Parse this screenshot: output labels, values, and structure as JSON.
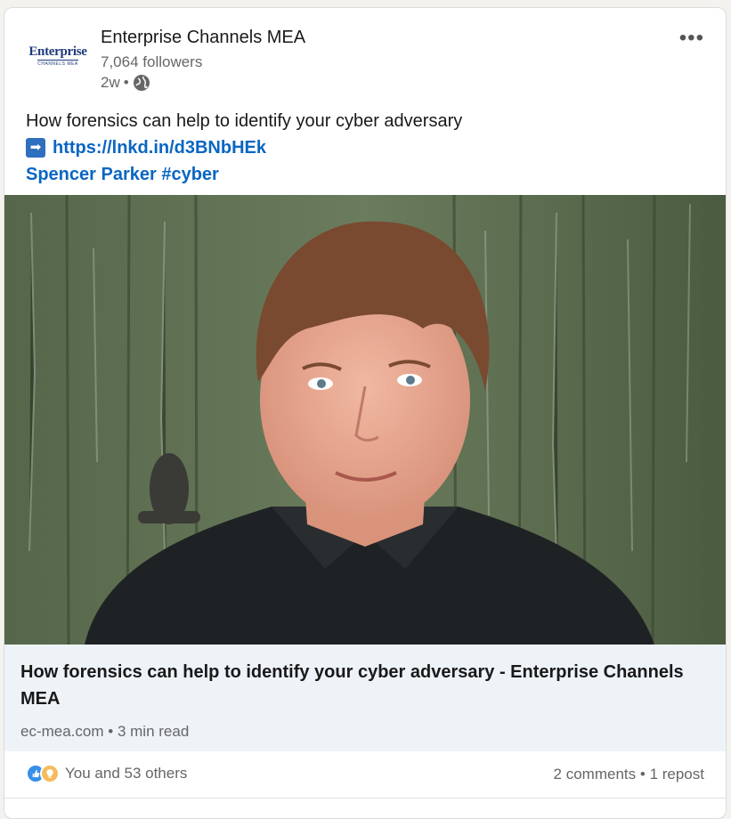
{
  "post": {
    "org_name": "Enterprise Channels MEA",
    "logo_text": "Enterprise",
    "logo_subtext": "CHANNELS MEA",
    "followers": "7,064 followers",
    "time_ago": "2w",
    "visibility_icon": "globe-icon",
    "more_icon": "more-options-icon",
    "more_label": "•••",
    "text_line1": "How forensics can help to identify your cyber adversary",
    "arrow_label": "➡",
    "link": "https://lnkd.in/d3BNbHEk",
    "mention": "Spencer Parker",
    "hashtag": "#cyber"
  },
  "article": {
    "title": "How forensics can help to identify your cyber adversary - Enterprise Channels MEA",
    "source": "ec-mea.com",
    "read_time": "3 min read"
  },
  "social": {
    "reaction_text": "You and 53 others",
    "comments": "2 comments",
    "reposts": "1 repost",
    "reaction_icons": [
      "like-icon",
      "idea-icon"
    ]
  },
  "colors": {
    "link_blue": "#0a66c2",
    "article_bg": "#eef3f8"
  }
}
